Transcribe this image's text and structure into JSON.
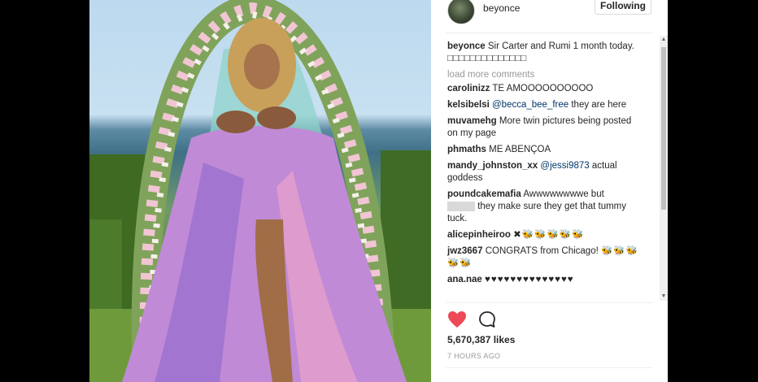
{
  "post": {
    "username": "beyonce",
    "follow_label": "Following",
    "caption_user": "beyonce",
    "caption_text": "Sir Carter and Rumi 1 month today. □□□□□□□□□□□□□□",
    "load_more": "load more comments",
    "likes": "5,670,387 likes",
    "time": "7 HOURS AGO"
  },
  "comments": [
    {
      "user": "carolinizz",
      "text": "TE AMOOOOOOOOOO"
    },
    {
      "user": "kelsibelsi",
      "mention": "@becca_bee_free",
      "text": "they are here"
    },
    {
      "user": "muvamehg",
      "text": "More twin pictures being posted on my page"
    },
    {
      "user": "phmaths",
      "text": "ME ABENÇOA"
    },
    {
      "user": "mandy_johnston_xx",
      "mention": "@jessi9873",
      "text": "actual goddess"
    },
    {
      "user": "poundcakemafia",
      "text": "Awwwwwwwwe but",
      "text2": "they make sure they get that tummy tuck."
    },
    {
      "user": "alicepinheiroo",
      "emoji": "✖🐝🐝🐝🐝🐝"
    },
    {
      "user": "jwz3667",
      "text": "CONGRATS from Chicago!",
      "emoji": "🐝🐝🐝🐝🐝"
    },
    {
      "user": "ana.nae",
      "emoji": "♥♥♥♥♥♥♥♥♥♥♥♥♥♥"
    }
  ],
  "icons": {
    "like": "heart-icon",
    "comment": "comment-bubble-icon",
    "heart_color": "#ed4956"
  }
}
